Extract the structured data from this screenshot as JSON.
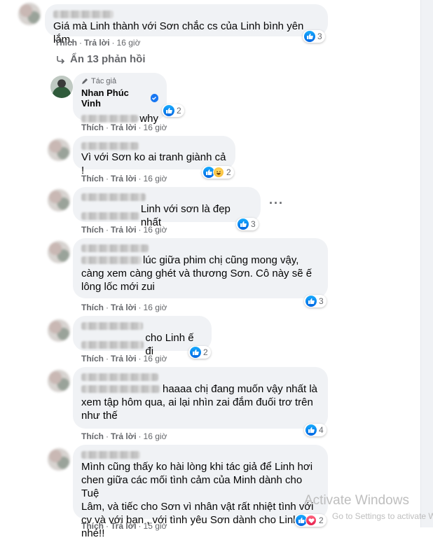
{
  "actions": {
    "like": "Thích",
    "reply": "Trả lời",
    "dot": "·"
  },
  "hide_replies": "Ẩn 13 phản hồi",
  "comments": [
    {
      "text": "Giá mà Linh thành với Sơn chắc cs của Linh bình yên lắm.",
      "time": "16 giờ",
      "reactions": "3"
    },
    {
      "badge": "Tác giả",
      "name": "Nhan Phúc Vinh",
      "text": "why",
      "time": "16 giờ",
      "reactions": "2"
    },
    {
      "text": "Vì với Sơn ko ai tranh giành cả !",
      "time": "16 giờ",
      "reactions": "2"
    },
    {
      "text": "Linh với sơn là đẹp nhất",
      "time": "16 giờ",
      "reactions": "3"
    },
    {
      "lines": [
        "lúc giữa phim chị cũng mong vậy,",
        "càng xem càng ghét và thương Sơn. Cô này sẽ ế",
        "lông lốc mới zui"
      ],
      "time": "16 giờ",
      "reactions": "3"
    },
    {
      "text": "cho Linh ế đi",
      "time": "16 giờ",
      "reactions": "2"
    },
    {
      "lines": [
        "haaaa chị đang muốn vậy nhất là",
        "xem tập hôm qua, ai lại nhìn zai đắm đuối trơ trên",
        "như thế"
      ],
      "time": "16 giờ",
      "reactions": "4"
    },
    {
      "lines": [
        "Mình cũng thấy ko hài lòng khi tác giả để Linh hơi",
        "chen giữa các mối tình cảm của Minh dành cho Tuệ",
        "Lâm, và tiếc cho Sơn vì nhân vật rất nhiệt tình với",
        "cv và với bạn , với tình yêu Sơn dành cho Linh nhé!!"
      ],
      "time": "15 giờ",
      "reactions": "2"
    }
  ],
  "watermark": {
    "title": "Activate Windows",
    "subtitle": "Go to Settings to activate Windows."
  },
  "colors": {
    "like_blue": "#0571ed",
    "bubble": "#f0f2f5",
    "meta": "#65676b"
  }
}
